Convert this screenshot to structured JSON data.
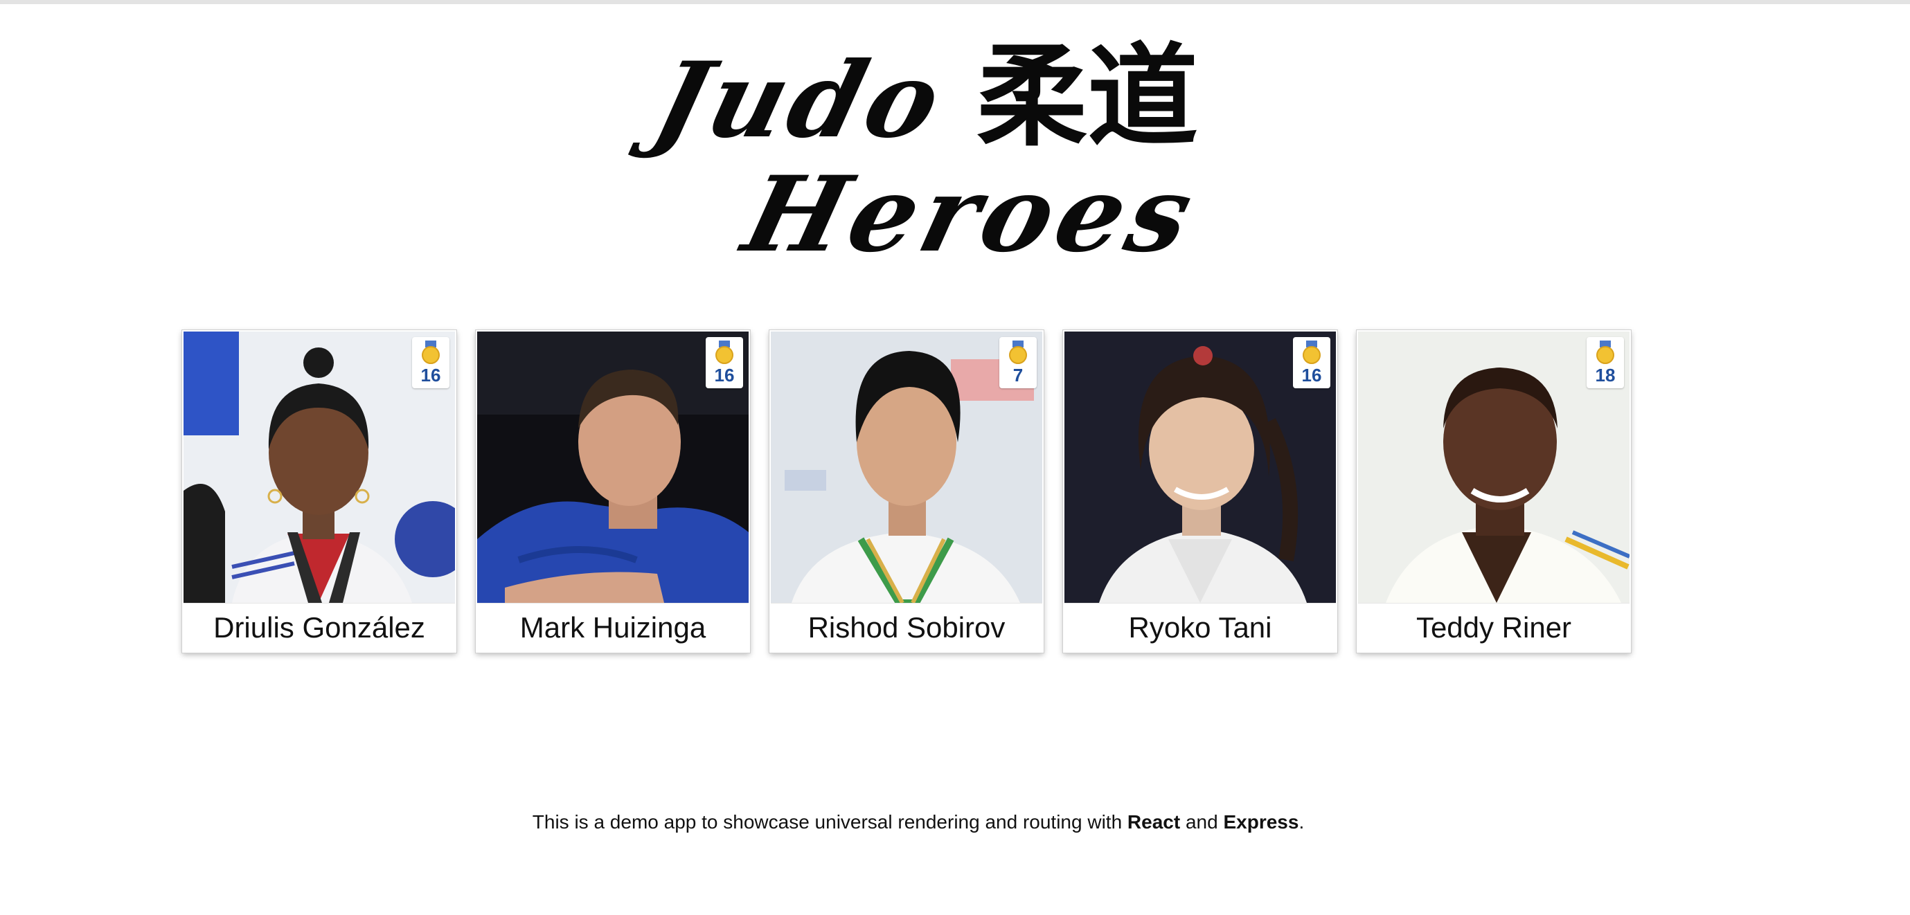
{
  "app": {
    "logo": {
      "line1": "Judo",
      "kanji": "柔道",
      "line2": "Heroes"
    }
  },
  "athletes": [
    {
      "name": "Driulis González",
      "medals": "16",
      "medal_icon": "gold-medal-icon"
    },
    {
      "name": "Mark Huizinga",
      "medals": "16",
      "medal_icon": "gold-medal-icon"
    },
    {
      "name": "Rishod Sobirov",
      "medals": "7",
      "medal_icon": "gold-medal-icon"
    },
    {
      "name": "Ryoko Tani",
      "medals": "16",
      "medal_icon": "gold-medal-icon"
    },
    {
      "name": "Teddy Riner",
      "medals": "18",
      "medal_icon": "gold-medal-icon"
    }
  ],
  "footer": {
    "prefix": "This is a demo app to showcase universal rendering and routing with ",
    "react": "React",
    "and": " and ",
    "express": "Express",
    "suffix": "."
  },
  "colors": {
    "medal_count": "#1f4e9c",
    "medal_gold": "#f2c232",
    "text": "#111111",
    "background": "#ffffff"
  }
}
